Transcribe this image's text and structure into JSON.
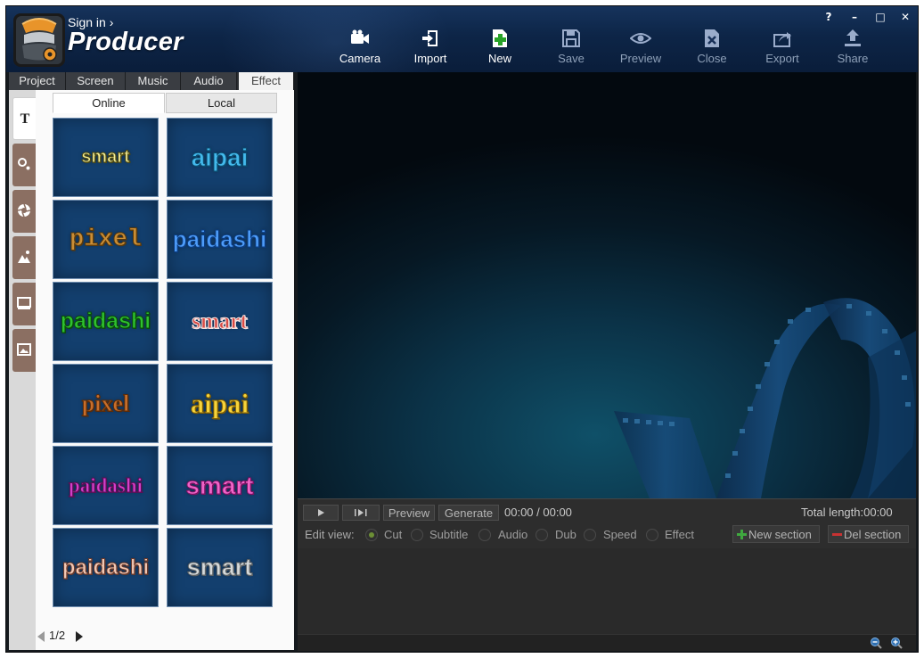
{
  "app": {
    "sign_in": "Sign in ›",
    "title": "Producer"
  },
  "toolbar": [
    {
      "label": "Camera",
      "icon": "camera-icon",
      "enabled": true
    },
    {
      "label": "Import",
      "icon": "import-icon",
      "enabled": true
    },
    {
      "label": "New",
      "icon": "new-icon",
      "enabled": true
    },
    {
      "label": "Save",
      "icon": "save-icon",
      "enabled": false
    },
    {
      "label": "Preview",
      "icon": "eye-icon",
      "enabled": false
    },
    {
      "label": "Close",
      "icon": "close-doc-icon",
      "enabled": false
    },
    {
      "label": "Export",
      "icon": "export-icon",
      "enabled": false
    },
    {
      "label": "Share",
      "icon": "share-icon",
      "enabled": false
    }
  ],
  "window_controls": {
    "help": "?",
    "minimize": "–",
    "maximize": "□",
    "close": "✕"
  },
  "main_tabs": [
    "Project",
    "Screen",
    "Music",
    "Audio",
    "Effect"
  ],
  "active_main_tab": "Effect",
  "side_tools": [
    "text-tool-icon",
    "particle-tool-icon",
    "shutter-tool-icon",
    "image-tool-icon",
    "screen-tool-icon",
    "picture-tool-icon"
  ],
  "side_text_glyph": "T",
  "sub_tabs": {
    "online": "Online",
    "local": "Local",
    "active": "Online"
  },
  "effects": [
    {
      "text": "smart",
      "color": "#f3ee9a",
      "stroke": "#4f4a12",
      "font": "Liberation Sans",
      "size": 20
    },
    {
      "text": "aipai",
      "color": "#43b9ec",
      "stroke": "#0c4c70",
      "font": "Liberation Sans",
      "size": 28
    },
    {
      "text": "pixel",
      "color": "#c98d36",
      "stroke": "#5a3a0c",
      "font": "Liberation Mono",
      "size": 27
    },
    {
      "text": "paidashi",
      "color": "#4e9dfa",
      "stroke": "#0c3d80",
      "font": "Liberation Sans",
      "size": 26
    },
    {
      "text": "paidashi",
      "color": "#2fc12f",
      "stroke": "#0a4d0a",
      "font": "Liberation Sans",
      "size": 25
    },
    {
      "text": "smart",
      "color": "#d94a44",
      "stroke": "#f5e2e0",
      "font": "Liberation Serif",
      "size": 25
    },
    {
      "text": "pixel",
      "color": "#c76e2c",
      "stroke": "#5b2c0a",
      "font": "Liberation Serif",
      "size": 26
    },
    {
      "text": "aipai",
      "color": "#f7d43a",
      "stroke": "#7a5b07",
      "font": "Liberation Serif",
      "size": 31
    },
    {
      "text": "paidashi",
      "color": "#d33fc9",
      "stroke": "#5a0f55",
      "font": "Liberation Serif",
      "size": 23
    },
    {
      "text": "smart",
      "color": "#f064c8",
      "stroke": "#7a1464",
      "font": "Liberation Sans",
      "size": 28
    },
    {
      "text": "paidashi",
      "color": "#f2c8b4",
      "stroke": "#6a3a2c",
      "font": "Liberation Sans",
      "size": 24
    },
    {
      "text": "smart",
      "color": "#d5d9da",
      "stroke": "#5e6366",
      "font": "Liberation Sans",
      "size": 27
    }
  ],
  "pager": {
    "label": "1/2"
  },
  "timeline": {
    "preview": "Preview",
    "generate": "Generate",
    "time": "00:00 / 00:00",
    "total": "Total length:00:00",
    "edit_view_label": "Edit view:",
    "edit_options": [
      "Cut",
      "Subtitle",
      "Audio",
      "Dub",
      "Speed",
      "Effect"
    ],
    "selected_option": "Cut",
    "new_section": "New section",
    "del_section": "Del section"
  }
}
